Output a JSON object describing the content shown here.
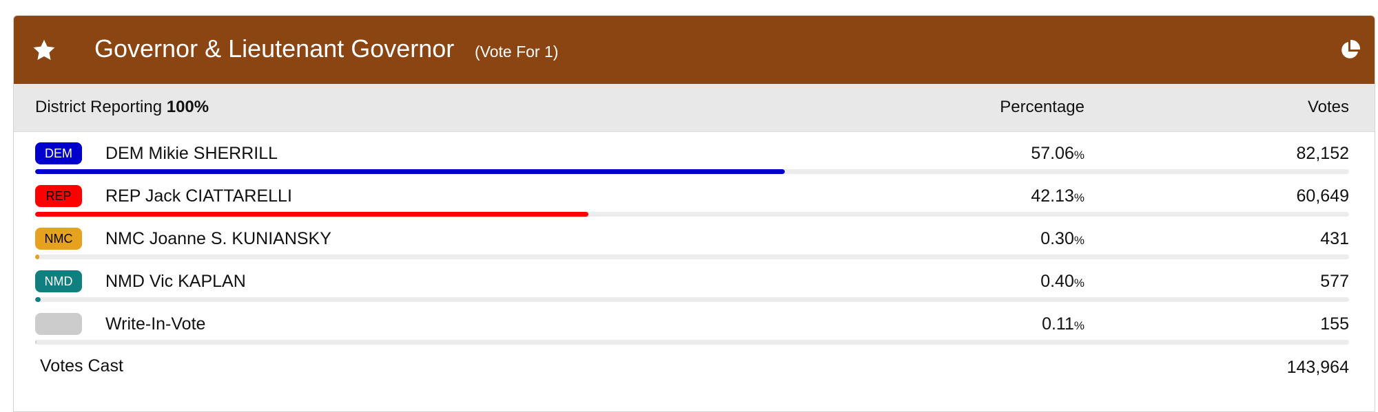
{
  "header": {
    "title": "Governor & Lieutenant Governor",
    "vote_for": "(Vote For 1)",
    "icon_left": "star-icon",
    "icon_right": "pie-chart-icon",
    "color": "#8b4513"
  },
  "subheader": {
    "reporting_label": "District Reporting",
    "reporting_value": "100%",
    "percentage_header": "Percentage",
    "votes_header": "Votes"
  },
  "candidates": [
    {
      "party": "DEM",
      "name": "DEM Mikie SHERRILL",
      "percent": "57.06",
      "percent_unit": "%",
      "votes": "82,152",
      "color": "#0000cc",
      "badge_text_color": "#ffffff",
      "bar_fraction": 0.5706
    },
    {
      "party": "REP",
      "name": "REP Jack CIATTARELLI",
      "percent": "42.13",
      "percent_unit": "%",
      "votes": "60,649",
      "color": "#ff0000",
      "badge_text_color": "#000000",
      "bar_fraction": 0.4213
    },
    {
      "party": "NMC",
      "name": "NMC Joanne S. KUNIANSKY",
      "percent": "0.30",
      "percent_unit": "%",
      "votes": "431",
      "color": "#e6a21e",
      "badge_text_color": "#000000",
      "bar_fraction": 0.003
    },
    {
      "party": "NMD",
      "name": "NMD Vic KAPLAN",
      "percent": "0.40",
      "percent_unit": "%",
      "votes": "577",
      "color": "#0f7f7f",
      "badge_text_color": "#ffffff",
      "bar_fraction": 0.004
    },
    {
      "party": "",
      "name": "Write-In-Vote",
      "percent": "0.11",
      "percent_unit": "%",
      "votes": "155",
      "color": "#cccccc",
      "badge_text_color": "#000000",
      "bar_fraction": 0.0011
    }
  ],
  "totals": {
    "label": "Votes Cast",
    "value": "143,964"
  }
}
